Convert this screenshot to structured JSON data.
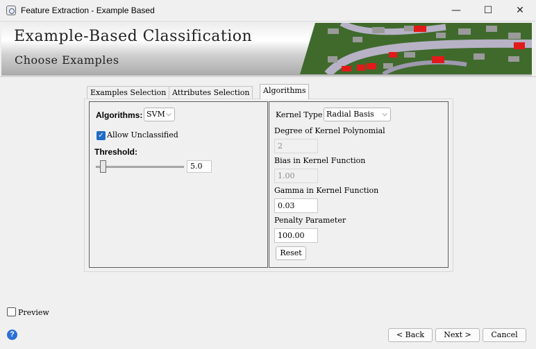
{
  "window": {
    "title": "Feature Extraction - Example Based",
    "min_glyph": "—",
    "max_glyph": "☐",
    "close_glyph": "✕",
    "app_icon": "envi-app-icon"
  },
  "banner": {
    "title": "Example-Based Classification",
    "subtitle": "Choose Examples",
    "image": "aerial-suburban-houses-red-roofs"
  },
  "tabs": [
    {
      "label": "Examples Selection",
      "active": false
    },
    {
      "label": "Attributes Selection",
      "active": false
    },
    {
      "label": "Algorithms",
      "active": true
    }
  ],
  "left": {
    "algorithms_label": "Algorithms:",
    "algorithm_value": "SVM",
    "allow_unclassified_label": "Allow Unclassified",
    "allow_unclassified_checked": true,
    "threshold_label": "Threshold:",
    "threshold_value": "5.0"
  },
  "right": {
    "kernel_type_label": "Kernel Type",
    "kernel_type_value": "Radial Basis",
    "degree_label": "Degree of Kernel Polynomial",
    "degree_value": "2",
    "bias_label": "Bias in Kernel Function",
    "bias_value": "1.00",
    "gamma_label": "Gamma in Kernel Function",
    "gamma_value": "0.03",
    "penalty_label": "Penalty Parameter",
    "penalty_value": "100.00",
    "reset_label": "Reset"
  },
  "footer": {
    "preview_label": "Preview",
    "preview_checked": false,
    "back_label": "< Back",
    "next_label": "Next >",
    "cancel_label": "Cancel",
    "help_glyph": "?"
  },
  "colors": {
    "accent": "#1f6cc4",
    "help": "#2a6fd4",
    "roof_red": "#e11a1a",
    "grass": "#3f6a2c",
    "road": "#b7b2c6"
  }
}
